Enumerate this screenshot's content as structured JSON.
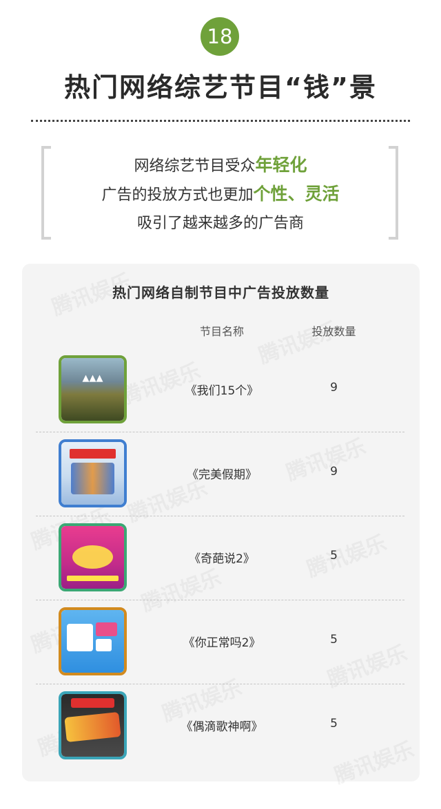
{
  "header": {
    "number": "18",
    "title": "热门网络综艺节目“钱”景"
  },
  "intro": {
    "line1_text": "网络综艺节目受众",
    "line1_highlight": "年轻化",
    "line2_text": "广告的投放方式也更加",
    "line2_highlight": "个性、灵活",
    "line3_text": "吸引了越来越多的广告商"
  },
  "table": {
    "title": "热门网络自制节目中广告投放数量",
    "columns": [
      "节目名称",
      "投放数量"
    ],
    "rows": [
      {
        "name": "《我们15个》",
        "count": "9",
        "thumb_border": "#6fa13a"
      },
      {
        "name": "《完美假期》",
        "count": "9",
        "thumb_border": "#3f7ed0"
      },
      {
        "name": "《奇葩说2》",
        "count": "5",
        "thumb_border": "#3aa874"
      },
      {
        "name": "《你正常吗2》",
        "count": "5",
        "thumb_border": "#d28a1e"
      },
      {
        "name": "《偶滴歌神啊》",
        "count": "5",
        "thumb_border": "#3aa5b8"
      }
    ]
  },
  "watermark": "腾讯娱乐",
  "colors": {
    "accent_green": "#6fa13a",
    "card_bg": "#f4f4f4"
  }
}
